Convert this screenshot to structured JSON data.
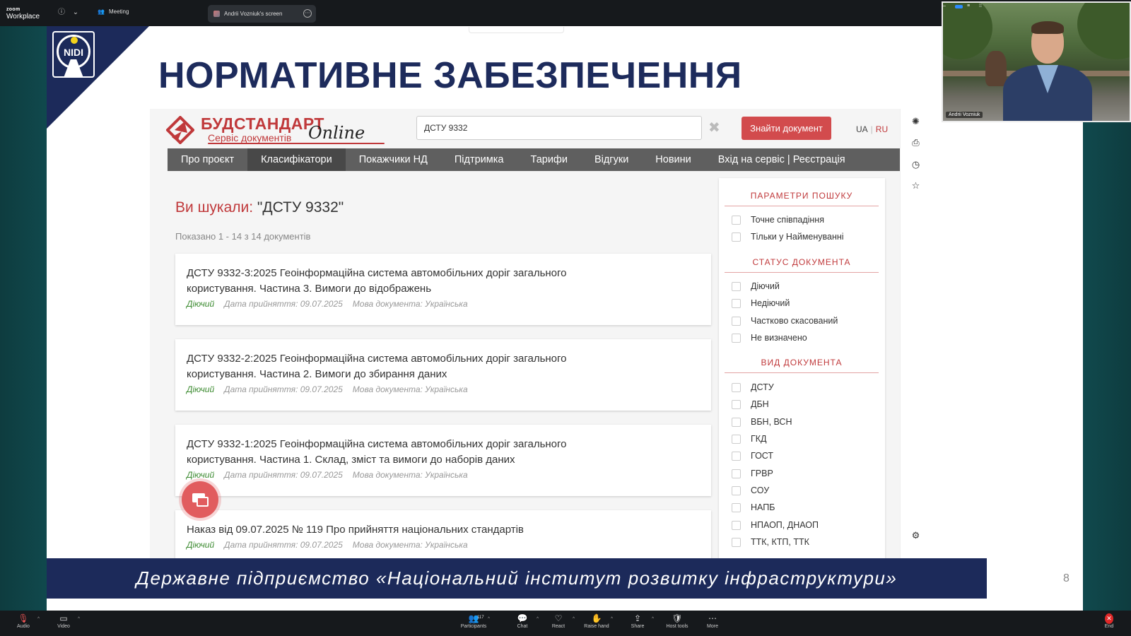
{
  "zoom": {
    "logo_top": "zoom",
    "logo_bottom": "Workplace",
    "meeting_label": "Meeting",
    "share_tab_label": "Andrii Vozniuk's screen",
    "participant_name": "Andrii Vozniuk",
    "participants_count": "117",
    "toolbar": {
      "audio": "Audio",
      "video": "Video",
      "participants": "Participants",
      "chat": "Chat",
      "react": "React",
      "raise_hand": "Raise hand",
      "share": "Share",
      "host_tools": "Host tools",
      "more": "More",
      "end": "End"
    }
  },
  "slide": {
    "logo_text": "NIDI",
    "title": "НОРМАТИВНЕ ЗАБЕЗПЕЧЕННЯ",
    "footer": "Державне підприємство «Національний інститут розвитку інфраструктури»",
    "page_number": "8"
  },
  "site": {
    "brand_main": "БУДСТАНДАРТ",
    "brand_sub": "Сервіс документів",
    "brand_online": "Online",
    "search_value": "ДСТУ 9332",
    "find_button": "Знайти документ",
    "lang_ua": "UA",
    "lang_sep": "|",
    "lang_ru": "RU",
    "nav": [
      "Про проєкт",
      "Класифікатори",
      "Покажчики НД",
      "Підтримка",
      "Тарифи",
      "Відгуки",
      "Новини",
      "Вхід на сервіс | Реєстрація"
    ],
    "you_searched_label": "Ви шукали:",
    "you_searched_query": " \"ДСТУ 9332\"",
    "shown_text": "Показано 1 - 14 з 14 документів",
    "results": [
      {
        "title_line1": "ДСТУ 9332-3:2025 Геоінформаційна система автомобільних доріг загального",
        "title_line2": "користування. Частина 3. Вимоги до відображень",
        "status": "Діючий",
        "date": "Дата прийняття: 09.07.2025",
        "lang": "Мова документа: Українська"
      },
      {
        "title_line1": "ДСТУ 9332-2:2025 Геоінформаційна система автомобільних доріг загального",
        "title_line2": "користування. Частина 2. Вимоги до збирання даних",
        "status": "Діючий",
        "date": "Дата прийняття: 09.07.2025",
        "lang": "Мова документа: Українська"
      },
      {
        "title_line1": "ДСТУ 9332-1:2025 Геоінформаційна система автомобільних доріг загального",
        "title_line2": "користування. Частина 1. Склад, зміст та вимоги до наборів даних",
        "status": "Діючий",
        "date": "Дата прийняття: 09.07.2025",
        "lang": "Мова документа: Українська"
      },
      {
        "title_line1": "Наказ від 09.07.2025 № 119 Про прийняття національних стандартів",
        "title_line2": "",
        "status": "Діючий",
        "date": "Дата прийняття: 09.07.2025",
        "lang": "Мова документа: Українська"
      }
    ],
    "panel": {
      "search_params_title": "ПАРАМЕТРИ ПОШУКУ",
      "search_params": [
        "Точне співпадіння",
        "Тільки у Найменуванні"
      ],
      "status_title": "СТАТУС ДОКУМЕНТА",
      "statuses": [
        "Діючий",
        "Недіючий",
        "Частково скасований",
        "Не визначено"
      ],
      "type_title": "ВИД ДОКУМЕНТА",
      "types": [
        "ДСТУ",
        "ДБН",
        "ВБН, ВСН",
        "ГКД",
        "ГОСТ",
        "ГРВР",
        "СОУ",
        "НАПБ",
        "НПАОП, ДНАОП",
        "ТТК, КТП, ТТК"
      ]
    }
  },
  "colors": {
    "brand_red": "#c0393b",
    "slide_navy": "#1c2a5a",
    "status_green": "#3b8a2f"
  }
}
